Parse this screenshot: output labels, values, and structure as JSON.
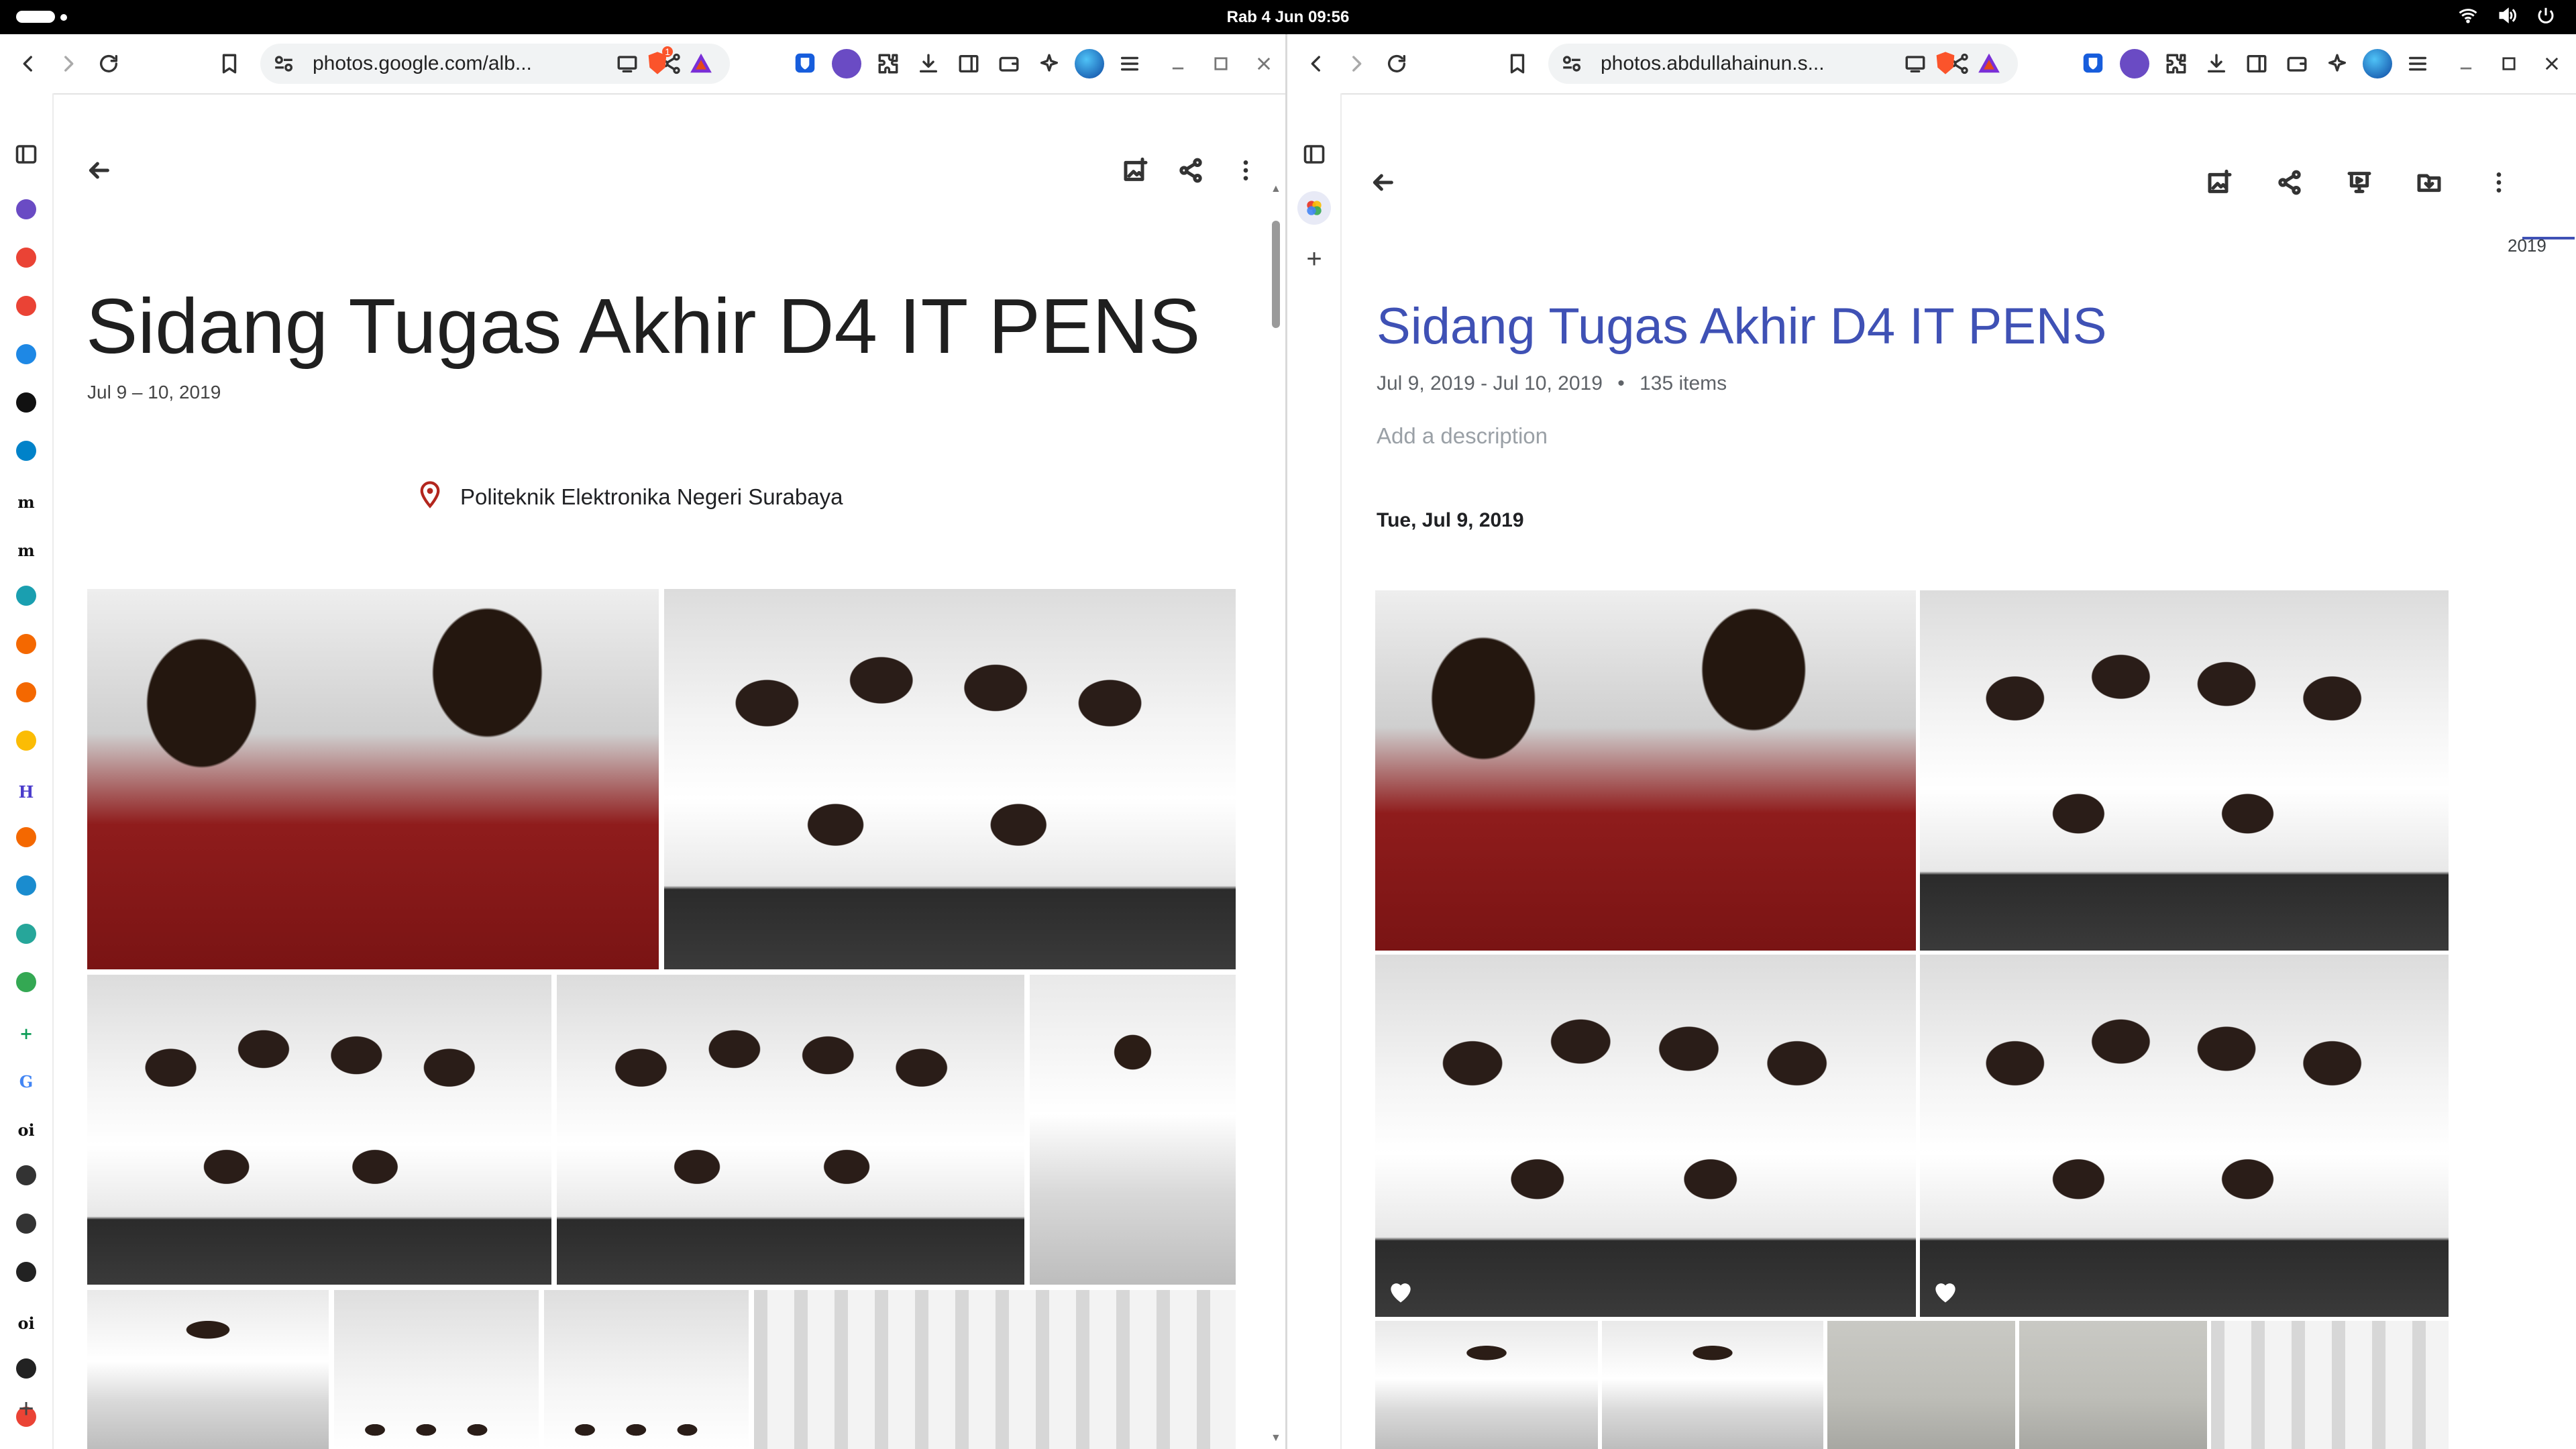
{
  "system": {
    "clock": "Rab   4 Jun  09:56"
  },
  "left_window": {
    "url": "photos.google.com/alb...",
    "album": {
      "title": "Sidang Tugas Akhir D4 IT PENS",
      "date": "Jul 9 – 10, 2019",
      "location": "Politeknik Elektronika Negeri Surabaya"
    },
    "brave_badge_count": "1"
  },
  "right_window": {
    "url": "photos.abdullahainun.s...",
    "album": {
      "title": "Sidang Tugas Akhir D4 IT PENS",
      "date_range": "Jul 9, 2019 - Jul 10, 2019",
      "separator": "•",
      "item_count": "135 items",
      "description_placeholder": "Add a description",
      "day_header": "Tue, Jul 9, 2019"
    },
    "timeline_year": "2019"
  },
  "colors": {
    "accent_blue": "#3f51b5",
    "brave_orange": "#fb542b",
    "bitwarden_blue": "#175ddc",
    "location_red": "#b3261e"
  },
  "sidebar_apps": [
    {
      "name": "tor-icon",
      "label": "",
      "color": "#6a4bc4"
    },
    {
      "name": "photos-icon",
      "label": "",
      "color": "#ea4335"
    },
    {
      "name": "photos-icon",
      "label": "",
      "color": "#ea4335"
    },
    {
      "name": "safari-icon",
      "label": "",
      "color": "#1e88e5"
    },
    {
      "name": "github-icon",
      "label": "",
      "color": "#111111"
    },
    {
      "name": "nextcloud-icon",
      "label": "",
      "color": "#0082c9"
    },
    {
      "name": "medium-icon",
      "label": "m",
      "color": "#111111"
    },
    {
      "name": "medium-icon",
      "label": "m",
      "color": "#111111"
    },
    {
      "name": "app-icon",
      "label": "",
      "color": "#1a9fb0"
    },
    {
      "name": "grafana-icon",
      "label": "",
      "color": "#f46800"
    },
    {
      "name": "grafana-icon",
      "label": "",
      "color": "#f46800"
    },
    {
      "name": "photos-icon",
      "label": "",
      "color": "#fbbc04"
    },
    {
      "name": "app-icon",
      "label": "H",
      "color": "#4b3ccc"
    },
    {
      "name": "grafana-icon",
      "label": "",
      "color": "#f46800"
    },
    {
      "name": "app-icon",
      "label": "",
      "color": "#1a8ccf"
    },
    {
      "name": "app-icon",
      "label": "",
      "color": "#26a69a"
    },
    {
      "name": "drive-icon",
      "label": "",
      "color": "#34a853"
    },
    {
      "name": "sheets-icon",
      "label": "+",
      "color": "#0f9d58"
    },
    {
      "name": "google-icon",
      "label": "G",
      "color": "#4285f4"
    },
    {
      "name": "app-icon",
      "label": "oi",
      "color": "#111111"
    },
    {
      "name": "globe-icon",
      "label": "",
      "color": "#333333"
    },
    {
      "name": "globe-icon",
      "label": "",
      "color": "#333333"
    },
    {
      "name": "app-icon",
      "label": "",
      "color": "#222222"
    },
    {
      "name": "app-icon",
      "label": "oi",
      "color": "#111111"
    },
    {
      "name": "app-icon",
      "label": "",
      "color": "#222222"
    },
    {
      "name": "photos-icon",
      "label": "",
      "color": "#ea4335"
    }
  ]
}
